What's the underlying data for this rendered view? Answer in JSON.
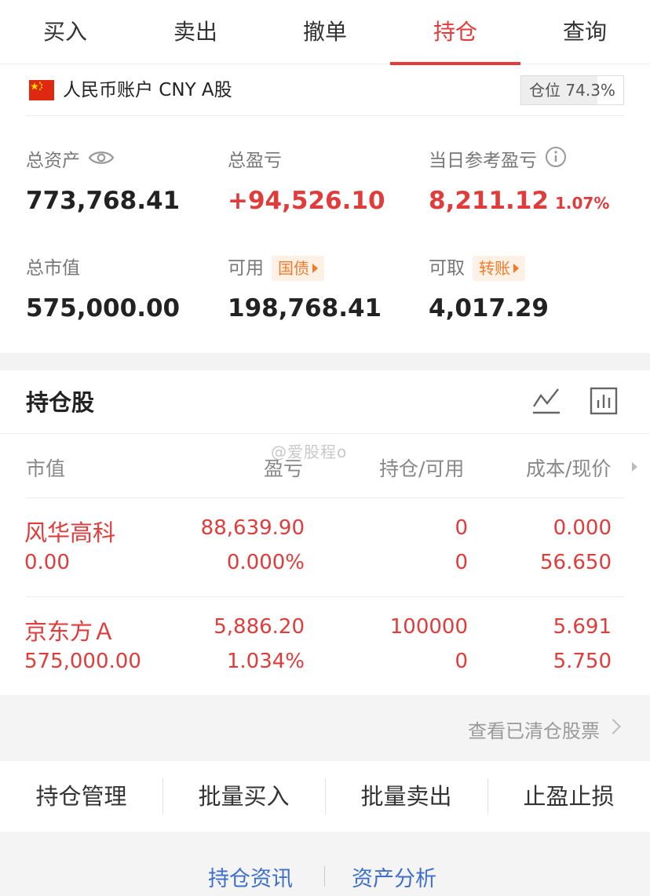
{
  "tabs": [
    {
      "label": "买入",
      "active": false
    },
    {
      "label": "卖出",
      "active": false
    },
    {
      "label": "撤单",
      "active": false
    },
    {
      "label": "持仓",
      "active": true
    },
    {
      "label": "查询",
      "active": false
    }
  ],
  "account": {
    "flag_icon": "china-flag-icon",
    "name": "人民币账户 CNY A股",
    "position_label": "仓位 74.3%",
    "position_fraction": 0.743
  },
  "summary": {
    "total_assets": {
      "label": "总资产",
      "value": "773,768.41",
      "icon": "eye-icon"
    },
    "total_pnl": {
      "label": "总盈亏",
      "value": "+94,526.10"
    },
    "daily_pnl": {
      "label": "当日参考盈亏",
      "value": "8,211.12",
      "percent": "1.07%",
      "icon": "info-icon"
    },
    "market_value": {
      "label": "总市值",
      "value": "575,000.00"
    },
    "available": {
      "label": "可用",
      "tag": "国债",
      "value": "198,768.41"
    },
    "withdrawable": {
      "label": "可取",
      "tag": "转账",
      "value": "4,017.29"
    }
  },
  "holdings": {
    "title": "持仓股",
    "icons": [
      "trend-line-icon",
      "bar-chart-icon"
    ],
    "columns": [
      "市值",
      "盈亏",
      "持仓/可用",
      "成本/现价"
    ],
    "watermark": "@爱股程o",
    "rows": [
      {
        "name": "风华高科",
        "market_value": "0.00",
        "pnl": "88,639.90",
        "pnl_pct": "0.000%",
        "hold": "0",
        "avail": "0",
        "cost": "0.000",
        "price": "56.650"
      },
      {
        "name": "京东方Ａ",
        "market_value": "575,000.00",
        "pnl": "5,886.20",
        "pnl_pct": "1.034%",
        "hold": "100000",
        "avail": "0",
        "cost": "5.691",
        "price": "5.750"
      }
    ],
    "cleared_link": "查看已清仓股票"
  },
  "actions": [
    "持仓管理",
    "批量买入",
    "批量卖出",
    "止盈止损"
  ],
  "footer": {
    "links": [
      "持仓资讯",
      "资产分析"
    ]
  },
  "colors": {
    "accent": "#e63a3a",
    "tag_orange": "#f07a2a",
    "link_blue": "#3e6fcc"
  }
}
